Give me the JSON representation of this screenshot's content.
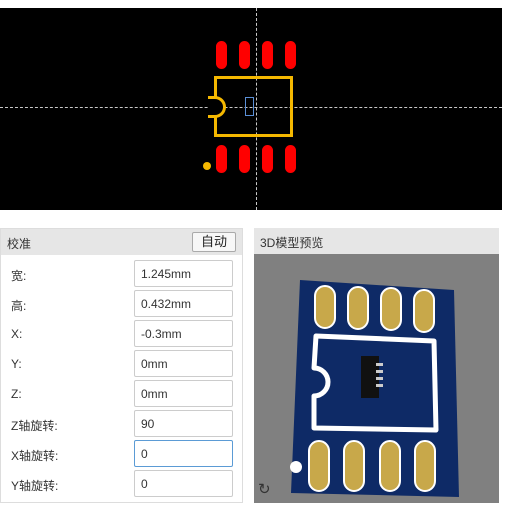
{
  "calibration": {
    "title": "校准",
    "auto_button": "自动",
    "fields": [
      {
        "label": "宽:",
        "value": "1.245mm"
      },
      {
        "label": "高:",
        "value": "0.432mm"
      },
      {
        "label": "X:",
        "value": "-0.3mm"
      },
      {
        "label": "Y:",
        "value": "0mm"
      },
      {
        "label": "Z:",
        "value": "0mm"
      },
      {
        "label": "Z轴旋转:",
        "value": "90"
      },
      {
        "label": "X轴旋转:",
        "value": "0"
      },
      {
        "label": "Y轴旋转:",
        "value": "0"
      }
    ]
  },
  "model_preview": {
    "title": "3D模型预览",
    "refresh_icon": "refresh-icon"
  },
  "colors": {
    "pad": "#ff0000",
    "silkscreen": "#f5b800",
    "board": "#0e2a66",
    "pad_3d": "#c8a84a"
  }
}
